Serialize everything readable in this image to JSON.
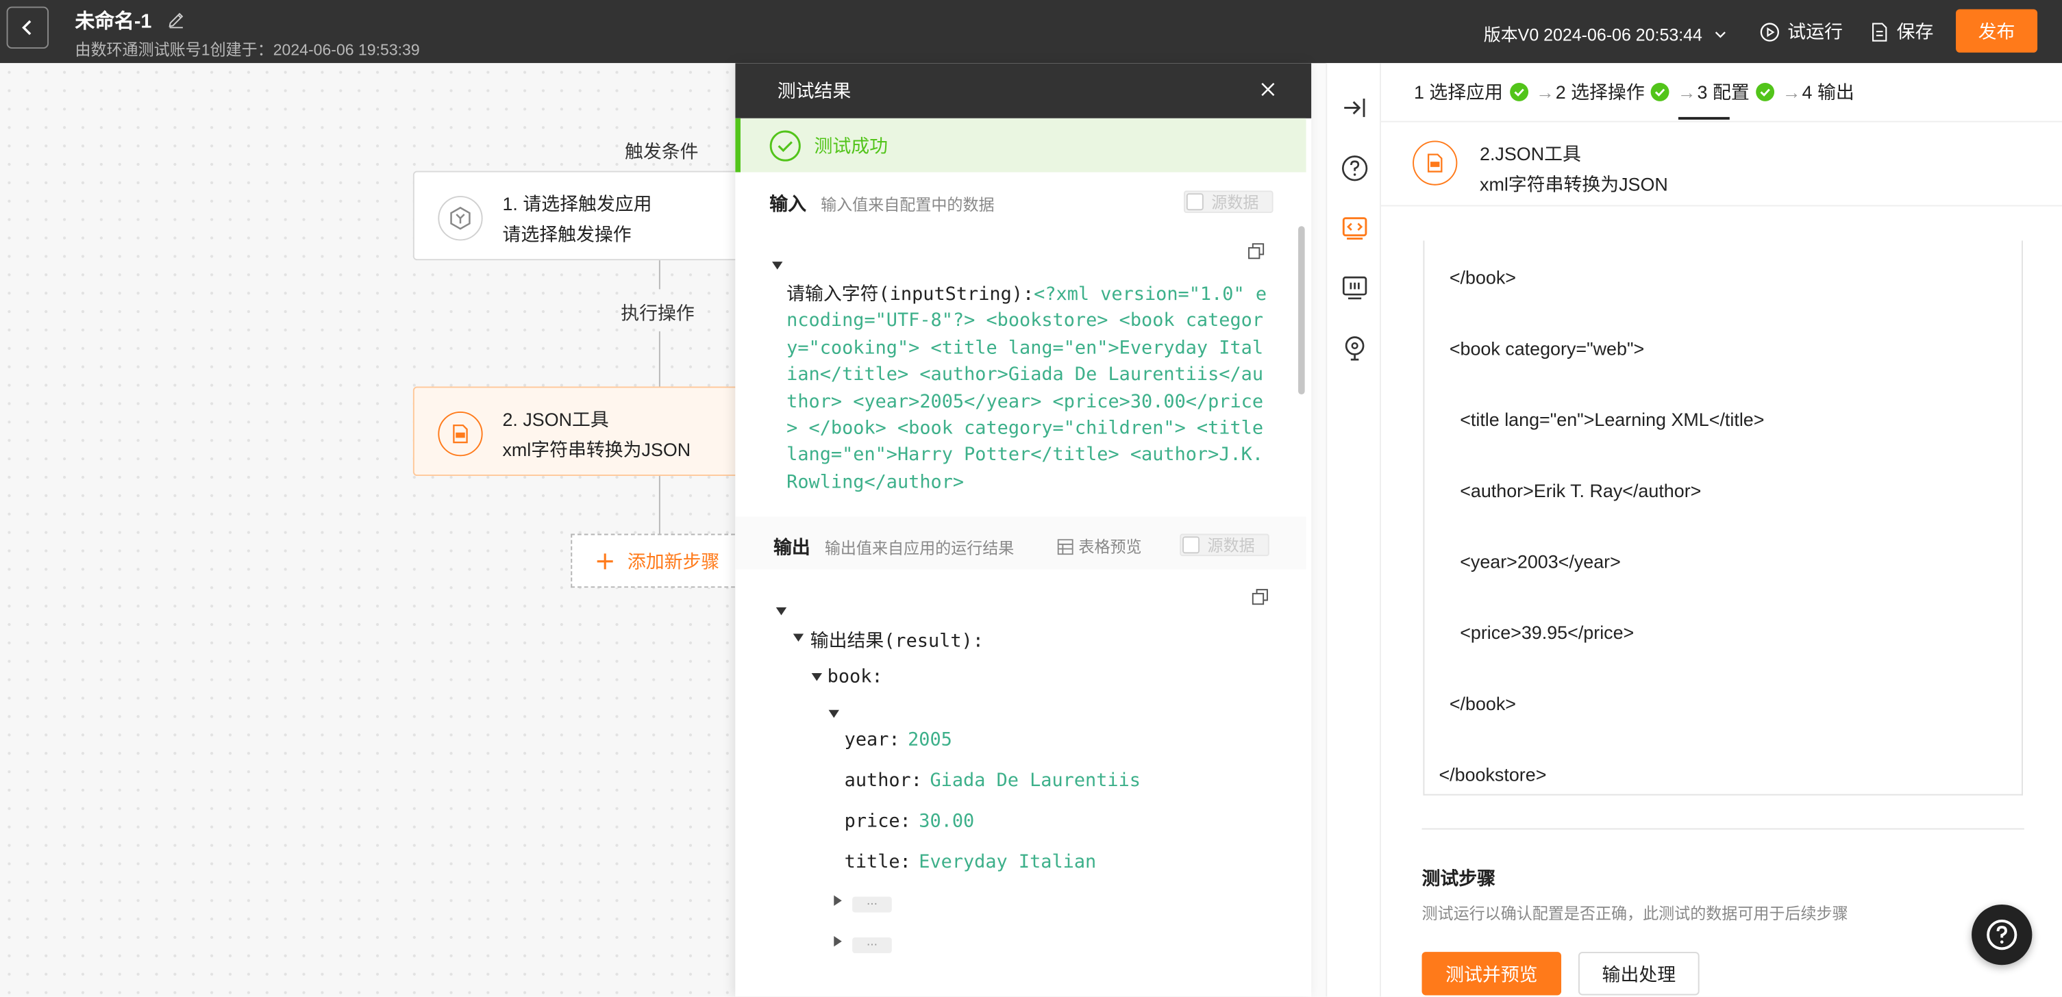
{
  "header": {
    "title": "未命名-1",
    "subtitle": "由数环通测试账号1创建于：2024-06-06 19:53:39",
    "version": "版本V0 2024-06-06 20:53:44",
    "trial_run": "试运行",
    "save": "保存",
    "publish": "发布"
  },
  "canvas": {
    "trigger_label": "触发条件",
    "node1": {
      "line1": "1. 请选择触发应用",
      "line2": "请选择触发操作"
    },
    "action_label": "执行操作",
    "node2": {
      "line1": "2. JSON工具",
      "line2": "xml字符串转换为JSON"
    },
    "add_step": "添加新步骤"
  },
  "test_panel": {
    "title": "测试结果",
    "success": "测试成功",
    "input_title": "输入",
    "input_hint": "输入值来自配置中的数据",
    "raw_toggle": "源数据",
    "input_key": "请输入字符(inputString):",
    "input_value": "<?xml version=\"1.0\" encoding=\"UTF-8\"?> <bookstore> <book category=\"cooking\"> <title lang=\"en\">Everyday Italian</title> <author>Giada De Laurentiis</author> <year>2005</year> <price>30.00</price> </book> <book category=\"children\"> <title lang=\"en\">Harry Potter</title> <author>J.K. Rowling</author>",
    "output_title": "输出",
    "output_hint": "输出值来自应用的运行结果",
    "table_preview": "表格预览",
    "result_key": "输出结果(result):",
    "book_key": "book:",
    "fields": [
      {
        "key": "year:",
        "value": "2005"
      },
      {
        "key": "author:",
        "value": "Giada De Laurentiis"
      },
      {
        "key": "price:",
        "value": "30.00"
      },
      {
        "key": "title:",
        "value": "Everyday Italian"
      }
    ],
    "collapsed": "..."
  },
  "config": {
    "steps": [
      "1 选择应用",
      "2 选择操作",
      "3 配置",
      "4 输出"
    ],
    "node_title": "2.JSON工具",
    "node_sub": "xml字符串转换为JSON",
    "xml_lines": [
      "</book>",
      "<book category=\"web\">",
      "<title lang=\"en\">Learning XML</title>",
      "<author>Erik T. Ray</author>",
      "<year>2003</year>",
      "<price>39.95</price>",
      "</book>",
      "</bookstore>"
    ],
    "test_title": "测试步骤",
    "test_desc": "测试运行以确认配置是否正确，此测试的数据可用于后续步骤",
    "test_button": "测试并预览",
    "output_button": "输出处理"
  },
  "colors": {
    "accent": "#ff7a1a",
    "success": "#52c41a",
    "value_text": "#3db08a",
    "topbar": "#333333"
  }
}
